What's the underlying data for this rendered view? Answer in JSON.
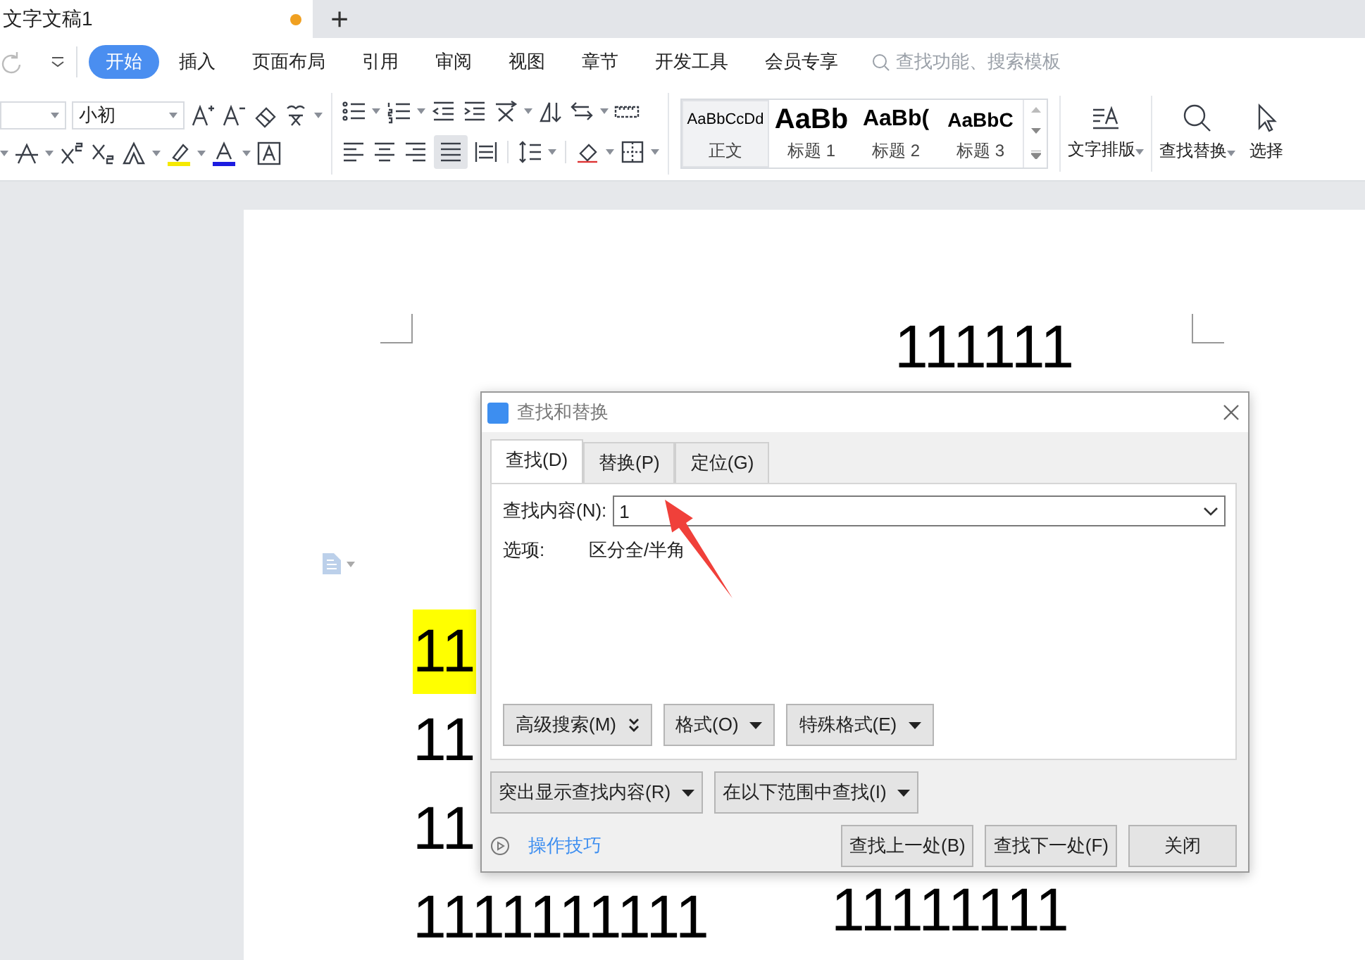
{
  "tabbar": {
    "doc_title": "文字文稿1",
    "unsaved": true,
    "new_tab": "+"
  },
  "menu": {
    "items": [
      {
        "label": "开始",
        "selected": true
      },
      {
        "label": "插入",
        "selected": false
      },
      {
        "label": "页面布局",
        "selected": false
      },
      {
        "label": "引用",
        "selected": false
      },
      {
        "label": "审阅",
        "selected": false
      },
      {
        "label": "视图",
        "selected": false
      },
      {
        "label": "章节",
        "selected": false
      },
      {
        "label": "开发工具",
        "selected": false
      },
      {
        "label": "会员专享",
        "selected": false
      }
    ],
    "search": {
      "placeholder": "查找功能、搜索模板"
    }
  },
  "ribbon": {
    "font_size": "小初",
    "styles": [
      {
        "sample": "AaBbCcDd",
        "label": "正文",
        "selected": true
      },
      {
        "sample": "AaBb",
        "label": "标题 1",
        "selected": false
      },
      {
        "sample": "AaBb(",
        "label": "标题 2",
        "selected": false
      },
      {
        "sample": "AaBbC",
        "label": "标题 3",
        "selected": false
      }
    ],
    "big_buttons": [
      {
        "label": "文字排版",
        "kind": "layout"
      },
      {
        "label": "查找替换",
        "kind": "search"
      },
      {
        "label": "选择",
        "kind": "select"
      }
    ]
  },
  "document": {
    "fragments": [
      {
        "text": "111111",
        "highlighted": false
      },
      {
        "text": "11",
        "highlighted": true
      },
      {
        "text": "11",
        "highlighted": false
      },
      {
        "text": "11",
        "highlighted": false
      },
      {
        "text": "1111111111",
        "highlighted": false
      },
      {
        "text": "11111111",
        "highlighted": false
      }
    ]
  },
  "dialog": {
    "title": "查找和替换",
    "tabs": [
      {
        "label": "查找(D)",
        "selected": true
      },
      {
        "label": "替换(P)",
        "selected": false
      },
      {
        "label": "定位(G)",
        "selected": false
      }
    ],
    "find": {
      "label": "查找内容(N):",
      "value": "1"
    },
    "options": {
      "label": "选项:",
      "value": "区分全/半角"
    },
    "panel_buttons": [
      {
        "label": "高级搜索(M)",
        "kind": "expand"
      },
      {
        "label": "格式(O)",
        "kind": "menu"
      },
      {
        "label": "特殊格式(E)",
        "kind": "menu"
      }
    ],
    "scope_buttons": [
      {
        "label": "突出显示查找内容(R)",
        "kind": "menu"
      },
      {
        "label": "在以下范围中查找(I)",
        "kind": "menu"
      }
    ],
    "tips_link": "操作技巧",
    "actions": [
      {
        "label": "查找上一处(B)"
      },
      {
        "label": "查找下一处(F)"
      },
      {
        "label": "关闭"
      }
    ]
  }
}
